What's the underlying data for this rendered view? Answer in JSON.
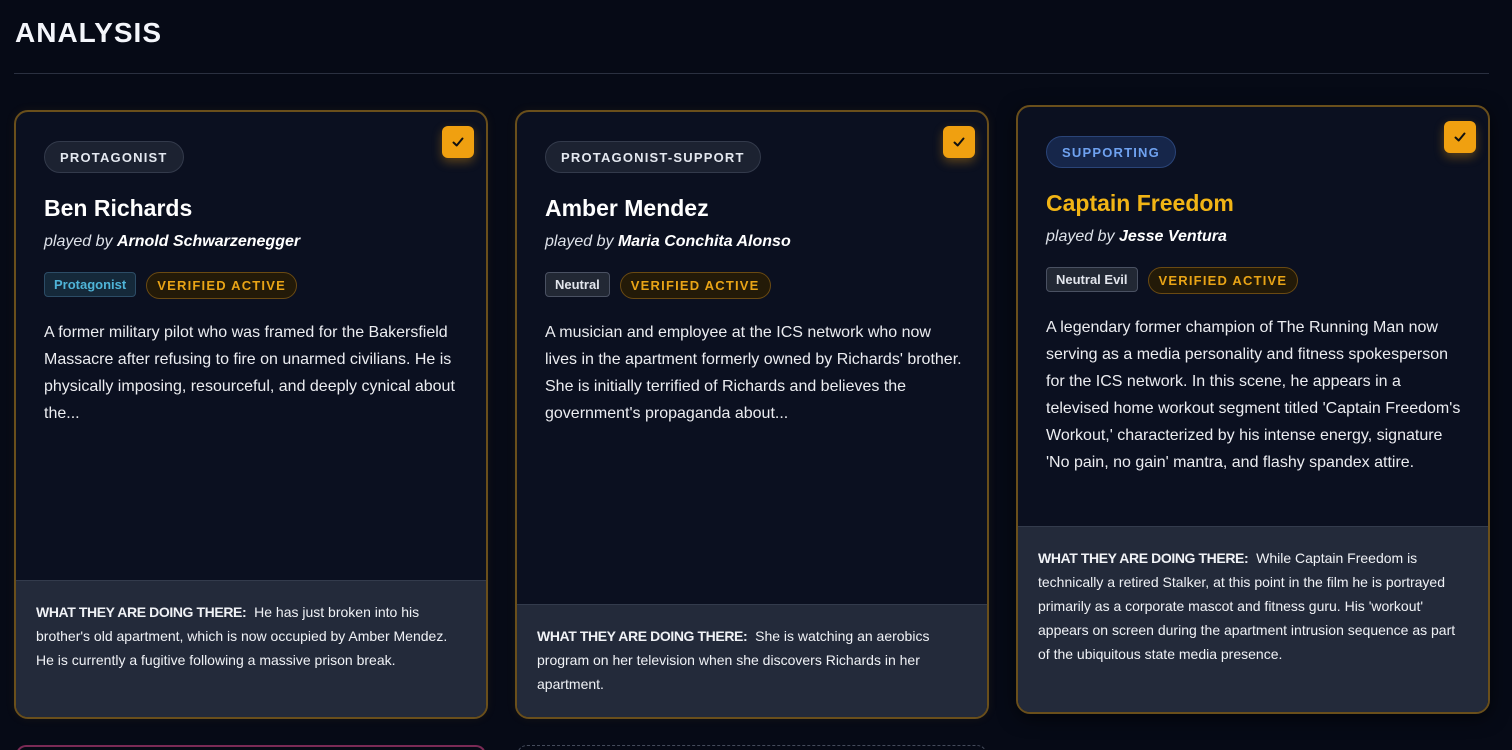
{
  "page": {
    "title": "ANALYSIS"
  },
  "cards": [
    {
      "role": "PROTAGONIST",
      "name": "Ben Richards",
      "played_by_prefix": "played by",
      "actor": "Arnold Schwarzenegger",
      "alignment": "Protagonist",
      "status": "VERIFIED ACTIVE",
      "description": "A former military pilot who was framed for the Bakersfield Massacre after refusing to fire on unarmed civilians. He is physically imposing, resourceful, and deeply cynical about the...",
      "doing_label": "WHAT THEY ARE DOING THERE:",
      "doing_text": "He has just broken into his brother's old apartment, which is now occupied by Amber Mendez. He is currently a fugitive following a massive prison break."
    },
    {
      "role": "PROTAGONIST-SUPPORT",
      "name": "Amber Mendez",
      "played_by_prefix": "played by",
      "actor": "Maria Conchita Alonso",
      "alignment": "Neutral",
      "status": "VERIFIED ACTIVE",
      "description": "A musician and employee at the ICS network who now lives in the apartment formerly owned by Richards' brother. She is initially terrified of Richards and believes the government's propaganda about...",
      "doing_label": "WHAT THEY ARE DOING THERE:",
      "doing_text": "She is watching an aerobics program on her television when she discovers Richards in her apartment."
    },
    {
      "role": "SUPPORTING",
      "name": "Captain Freedom",
      "played_by_prefix": "played by",
      "actor": "Jesse Ventura",
      "alignment": "Neutral Evil",
      "status": "VERIFIED ACTIVE",
      "description": "A legendary former champion of The Running Man now serving as a media personality and fitness spokesperson for the ICS network. In this scene, he appears in a televised home workout segment titled 'Captain Freedom's Workout,' characterized by his intense energy, signature 'No pain, no gain' mantra, and flashy spandex attire.",
      "doing_label": "WHAT THEY ARE DOING THERE:",
      "doing_text": "While Captain Freedom is technically a retired Stalker, at this point in the film he is portrayed primarily as a corporate mascot and fitness guru. His 'workout' appears on screen during the apartment intrusion sequence as part of the ubiquitous state media presence."
    }
  ],
  "icons": {
    "selected": "checkmark-icon"
  },
  "colors": {
    "accent": "#f0a010",
    "card_border": "#6a4f1b",
    "gold_name": "#f1b415",
    "supporting_blue": "#6fa2f0",
    "protagonist_teal": "#4fb4d8"
  }
}
